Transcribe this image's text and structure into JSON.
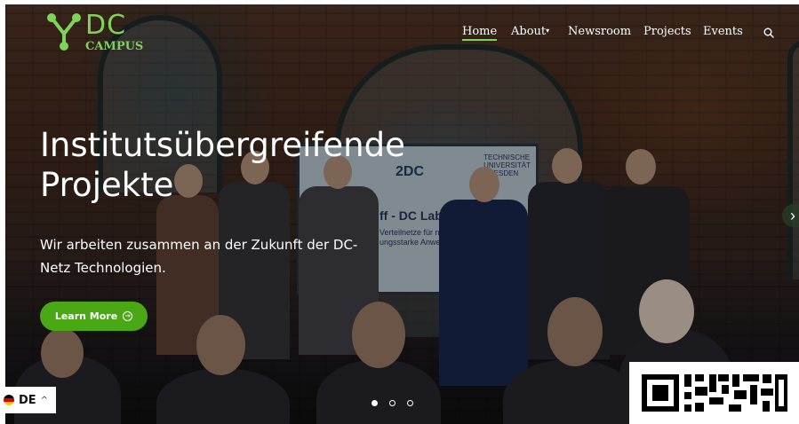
{
  "brand": {
    "dc": "DC",
    "campus": "CAMPUS",
    "accent": "#7fd35b"
  },
  "nav": {
    "home": "Home",
    "about": "About",
    "newsroom": "Newsroom",
    "projects": "Projects",
    "events": "Events"
  },
  "hero": {
    "headline_1": "Institutsübergreifende",
    "headline_2": "Projekte",
    "subline_1": "Wir arbeiten zusammen an der Zukunft der DC-",
    "subline_2": "Netz Technologien.",
    "cta": "Learn More",
    "screen_logo": "2DC",
    "screen_title": "ff - DC LabS",
    "screen_sub_1": "Verteilnetze für nach",
    "screen_sub_2": "ungsstarke Anwend",
    "screen_tu_1": "TECHNISCHE",
    "screen_tu_2": "UNIVERSITÄT",
    "screen_tu_3": "DRESDEN"
  },
  "carousel": {
    "slides": 3,
    "active": 1,
    "next_icon": "chevron-right-icon"
  },
  "language": {
    "code": "DE",
    "flag": "german-flag-icon"
  },
  "icons": {
    "search": "search-icon",
    "dropdown": "caret-down-icon"
  },
  "colors": {
    "cta": "#4aa814",
    "overlay": "rgba(0,0,0,0.38)"
  }
}
